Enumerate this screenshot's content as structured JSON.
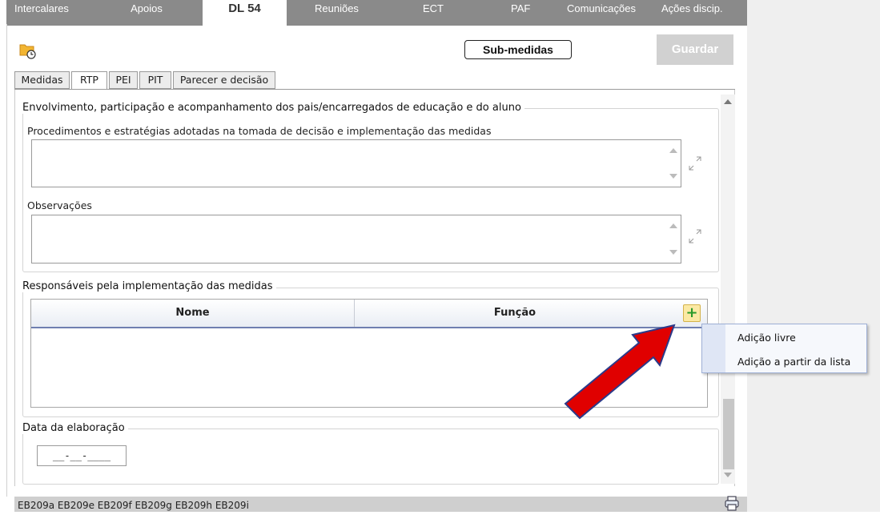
{
  "nav": {
    "tabs": [
      "Intercalares",
      "Apoios",
      "DL 54",
      "Reuniões",
      "ECT",
      "PAF",
      "Comunicações",
      "Ações discip."
    ],
    "active": "DL 54"
  },
  "toolbar": {
    "folder_icon": "folder-clock-icon",
    "submedidas_label": "Sub-medidas",
    "save_label": "Guardar"
  },
  "tabs": {
    "items": [
      "Medidas",
      "RTP",
      "PEI",
      "PIT",
      "Parecer e decisão"
    ],
    "active": "RTP"
  },
  "section_parents": {
    "legend": "Envolvimento, participação e acompanhamento dos pais/encarregados de educação e do aluno",
    "procedures_label": "Procedimentos e estratégias adotadas na tomada de decisão e implementação das medidas",
    "procedures_value": "",
    "observations_label": "Observações",
    "observations_value": ""
  },
  "section_responsibles": {
    "legend": "Responsáveis pela implementação das medidas",
    "columns": [
      "Nome",
      "Função"
    ],
    "add_icon": "plus-icon",
    "rows": []
  },
  "context_menu": {
    "items": [
      "Adição livre",
      "Adição a partir da lista"
    ]
  },
  "section_date": {
    "legend": "Data da elaboração",
    "value": "__-__-____"
  },
  "footer": {
    "codes": "EB209a  EB209e  EB209f  EB209g  EB209h  EB209i",
    "printer_icon": "printer-icon"
  },
  "colors": {
    "nav_bg": "#8a8a8a",
    "save_disabled": "#d1d1d1",
    "arrow": "#e00000",
    "add_button": "#fbe9a4"
  }
}
